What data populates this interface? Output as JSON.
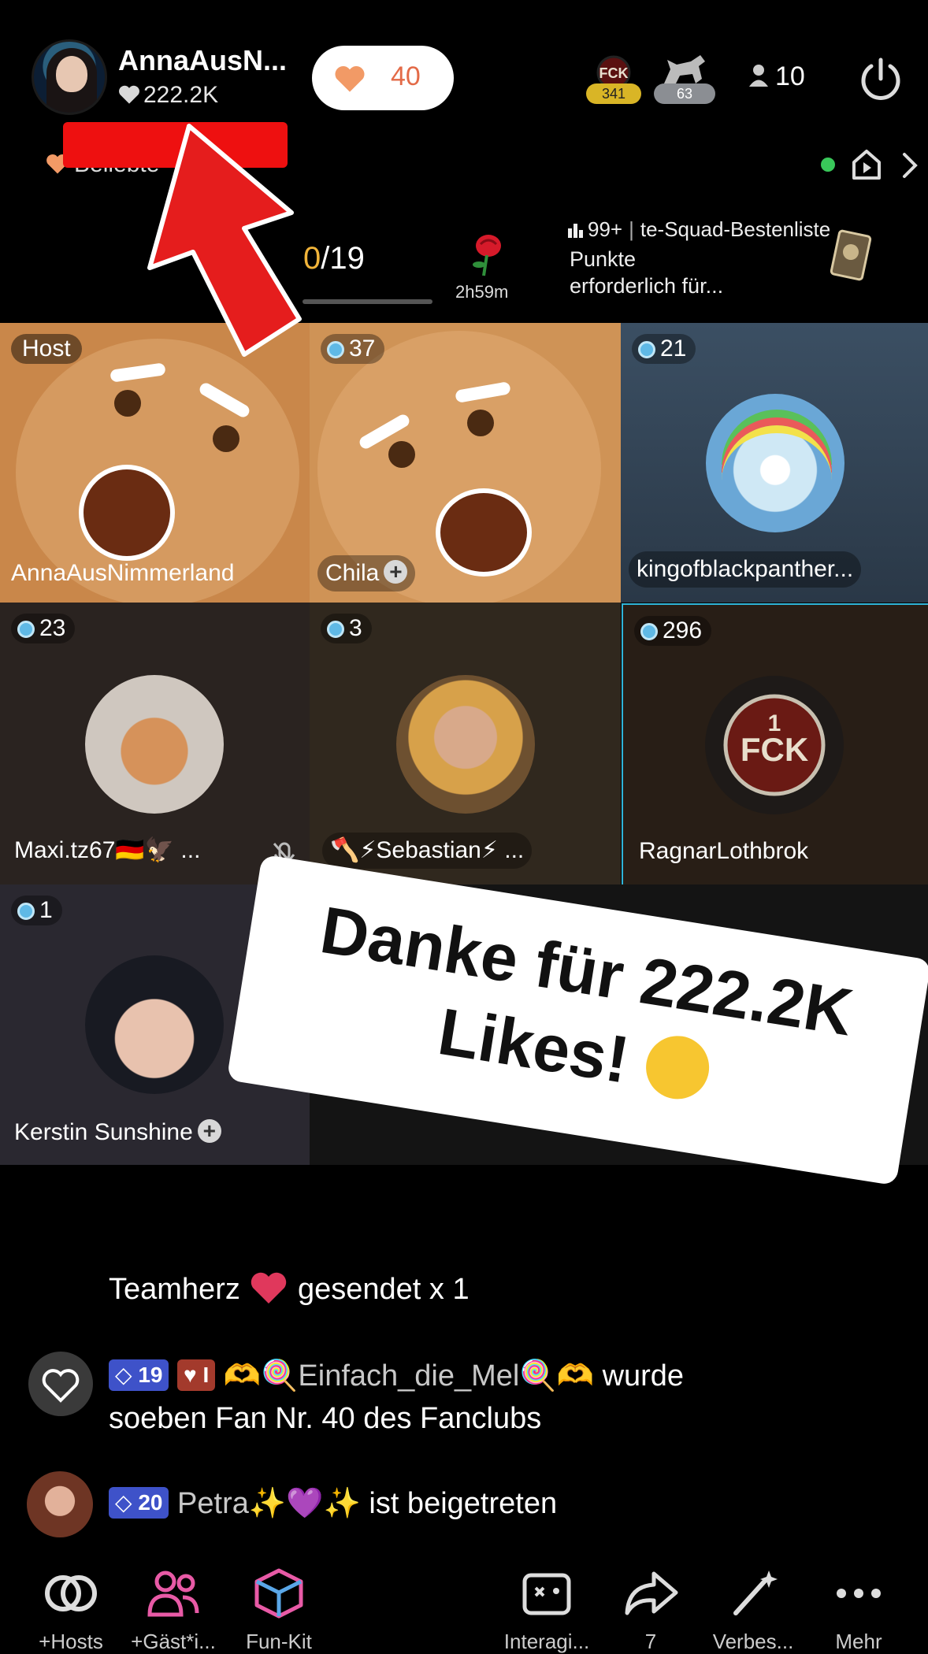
{
  "header": {
    "host_name": "AnnaAusN...",
    "host_likes": "222.2K",
    "fanclub_count": "40",
    "badge_a_count": "341",
    "badge_b_count": "63",
    "viewer_count": "10",
    "beliebt_label": "Beliebte"
  },
  "goal": {
    "current": "0",
    "total": "/19",
    "timer": "2h59m",
    "rank_count": "99+",
    "rank_label": "te-Squad-Bestenliste",
    "punkte_line1": "Punkte",
    "punkte_line2": "erforderlich für..."
  },
  "tiles": [
    {
      "level": "Host",
      "name": "AnnaAusNimmerland"
    },
    {
      "level": "37",
      "name": "Chila"
    },
    {
      "level": "21",
      "name": "kingofblackpanther..."
    },
    {
      "level": "23",
      "name": "Maxi.tz67🇩🇪🦅 ..."
    },
    {
      "level": "3",
      "name": "🪓⚡Sebastian⚡ ..."
    },
    {
      "level": "296",
      "name": "RagnarLothbrok"
    },
    {
      "level": "1",
      "name": "Kerstin Sunshine"
    }
  ],
  "sticker": {
    "line1": "Danke für 222.2K",
    "line2": "Likes!"
  },
  "chat": {
    "gift": {
      "name": "Teamherz",
      "text": "gesendet x 1"
    },
    "fan": {
      "badge_level": "19",
      "badge_fan": "I",
      "user": "🫶🍭Einfach_die_Mel🍭🫶",
      "text1": "wurde",
      "text2": "soeben Fan Nr. 40 des Fanclubs"
    },
    "join": {
      "badge_level": "20",
      "user": "Petra✨💜✨",
      "text": "ist beigetreten"
    }
  },
  "bottom_bar": {
    "hosts": "+Hosts",
    "guests": "+Gäst*i...",
    "funkit": "Fun-Kit",
    "interact": "Interagi...",
    "share_count": "7",
    "enhance": "Verbes...",
    "more": "Mehr"
  },
  "colors": {
    "background": "#000000",
    "redaction": "#ee1010",
    "progress_current": "#f1b43a",
    "fan_heart": "#f29a66",
    "online": "#39c85a",
    "pink_icon": "#e85aa6"
  }
}
